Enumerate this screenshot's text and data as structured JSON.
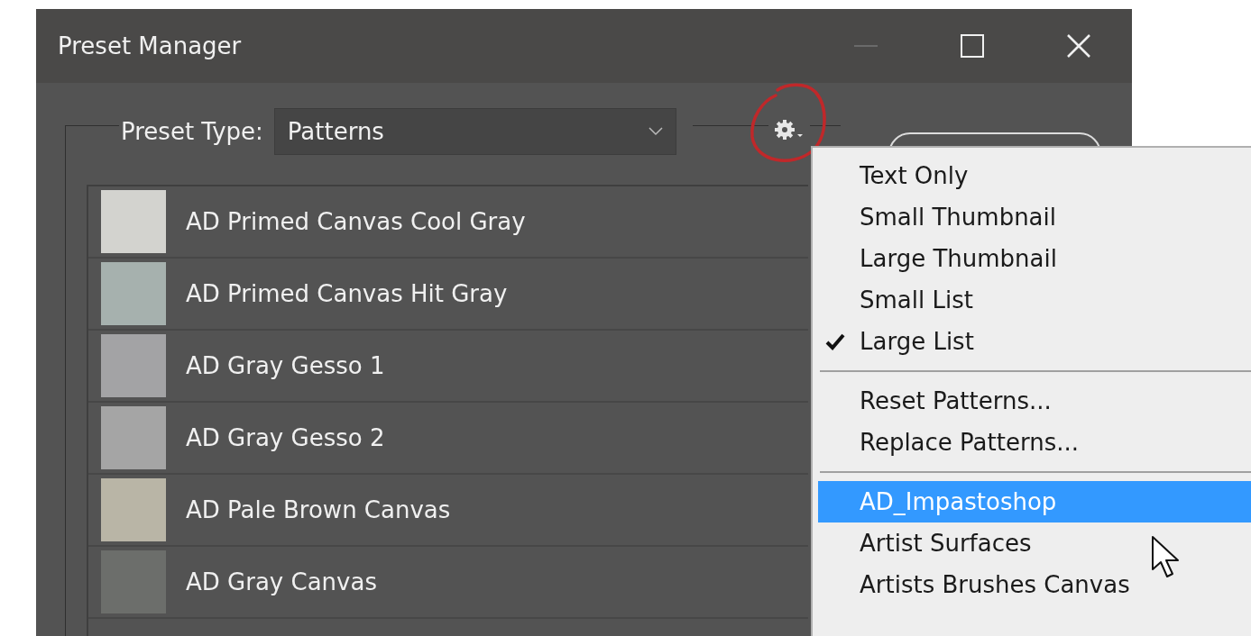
{
  "window": {
    "title": "Preset Manager"
  },
  "preset_type": {
    "label": "Preset Type:",
    "value": "Patterns"
  },
  "presets": [
    {
      "name": "AD Primed Canvas Cool Gray",
      "color": "#d3d3cf"
    },
    {
      "name": "AD Primed Canvas Hit Gray",
      "color": "#a6b1ae"
    },
    {
      "name": "AD Gray Gesso 1",
      "color": "#a3a3a5"
    },
    {
      "name": "AD Gray Gesso 2",
      "color": "#a5a5a5"
    },
    {
      "name": "AD Pale Brown Canvas",
      "color": "#b9b5a6"
    },
    {
      "name": "AD Gray Canvas",
      "color": "#6c6e6b"
    }
  ],
  "menu": {
    "items": [
      {
        "kind": "option",
        "label": "Text Only",
        "checked": false,
        "selected": false
      },
      {
        "kind": "option",
        "label": "Small Thumbnail",
        "checked": false,
        "selected": false
      },
      {
        "kind": "option",
        "label": "Large Thumbnail",
        "checked": false,
        "selected": false
      },
      {
        "kind": "option",
        "label": "Small List",
        "checked": false,
        "selected": false
      },
      {
        "kind": "option",
        "label": "Large List",
        "checked": true,
        "selected": false
      },
      {
        "kind": "separator"
      },
      {
        "kind": "option",
        "label": "Reset Patterns...",
        "checked": false,
        "selected": false
      },
      {
        "kind": "option",
        "label": "Replace Patterns...",
        "checked": false,
        "selected": false
      },
      {
        "kind": "separator"
      },
      {
        "kind": "option",
        "label": "AD_Impastoshop",
        "checked": false,
        "selected": true
      },
      {
        "kind": "option",
        "label": "Artist Surfaces",
        "checked": false,
        "selected": false
      },
      {
        "kind": "option",
        "label": "Artists Brushes Canvas",
        "checked": false,
        "selected": false
      }
    ]
  }
}
